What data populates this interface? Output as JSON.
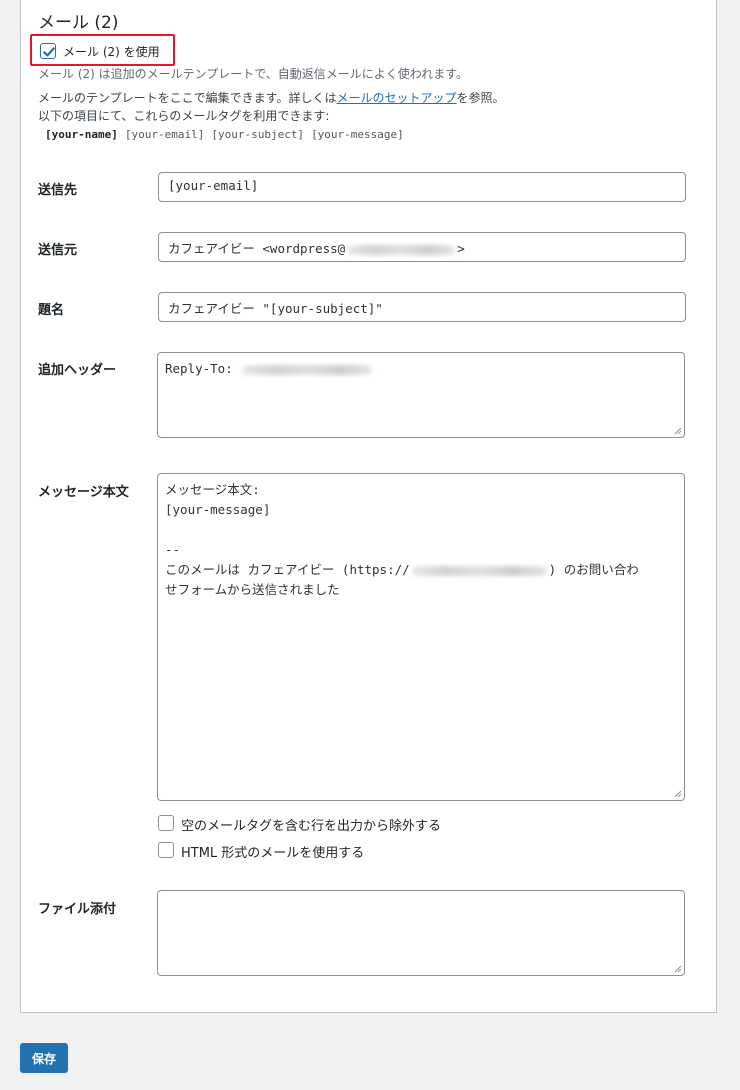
{
  "section": {
    "title": "メール (2)",
    "use_label": "メール (2) を使用",
    "use_checked": true,
    "desc1": "メール (2) は追加のメールテンプレートで、自動返信メールによく使われます。",
    "desc2_prefix": "メールのテンプレートをここで編集できます。詳しくは",
    "desc2_link": "メールのセットアップ",
    "desc2_suffix": "を参照。",
    "desc3": "以下の項目にて、これらのメールタグを利用できます:",
    "tags": [
      "[your-name]",
      "[your-email]",
      "[your-subject]",
      "[your-message]"
    ]
  },
  "fields": {
    "to": {
      "label": "送信先",
      "value": "[your-email]"
    },
    "from": {
      "label": "送信元",
      "value_prefix": "カフェアイビー <wordpress@",
      "value_suffix": ">"
    },
    "subject": {
      "label": "題名",
      "value": "カフェアイビー \"[your-subject]\""
    },
    "headers": {
      "label": "追加ヘッダー",
      "value_prefix": "Reply-To: "
    },
    "body": {
      "label": "メッセージ本文",
      "line1": "メッセージ本文:",
      "line2": "[your-message]",
      "line3": "--",
      "line4_prefix": "このメールは カフェアイビー (https://",
      "line4_suffix": ") のお問い合わ",
      "line5": "せフォームから送信されました"
    },
    "attachments": {
      "label": "ファイル添付",
      "value": ""
    }
  },
  "options": {
    "exclude_blank": "空のメールタグを含む行を出力から除外する",
    "html_mail": "HTML 形式のメールを使用する"
  },
  "save_label": "保存",
  "colors": {
    "accent": "#2271b1",
    "highlight": "#e0182b"
  }
}
